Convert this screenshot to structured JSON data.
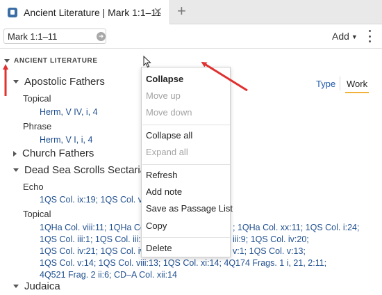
{
  "tab": {
    "title": "Ancient Literature | Mark 1:1–11",
    "close_label": "✕",
    "new_tab_label": "+"
  },
  "toolbar": {
    "reference_value": "Mark 1:1–11",
    "add_label": "Add"
  },
  "section": {
    "title": "ANCIENT LITERATURE"
  },
  "view_toggle": {
    "type_label": "Type",
    "work_label": "Work"
  },
  "tree": {
    "apostolic_fathers": {
      "label": "Apostolic Fathers",
      "topical": "Topical",
      "topical_refs": "Herm, V IV, i, 4",
      "phrase": "Phrase",
      "phrase_refs": "Herm, V I, i, 4"
    },
    "church_fathers": {
      "label": "Church Fathers"
    },
    "dead_sea": {
      "label": "Dead Sea Scrolls Sectarian",
      "echo": "Echo",
      "echo_refs": "1QS Col. ix:19; 1QS Col. viii",
      "topical": "Topical",
      "topical_lines": [
        "1QHa Col. viii:11; 1QHa Col.",
        "1QS Col. iii:1; 1QS Col. iii:4",
        "1QS Col. iv:21; 1QS Col. iv:",
        "1QS Col. v:14; 1QS Col. viii:13; 1QS Col. xi:14; 4Q174 Frags. 1 i, 21, 2:11;",
        "4Q521 Frag. 2 ii:6; CD–A Col. xii:14"
      ],
      "topical_right": [
        "; 1QHa Col. xx:11; 1QS Col. i:24;",
        "iii:9; 1QS Col. iv:20;",
        "v:1; 1QS Col. v:13;"
      ]
    },
    "judaica": {
      "label": "Judaica"
    }
  },
  "context_menu": {
    "items": [
      "Collapse",
      "Move up",
      "Move down",
      "Collapse all",
      "Expand all",
      "Refresh",
      "Add note",
      "Save as Passage List",
      "Copy",
      "Delete"
    ]
  },
  "colors": {
    "link": "#1f4f8f",
    "annotation_arrow": "#e03030",
    "active_tab_underline": "#f0b23a"
  }
}
